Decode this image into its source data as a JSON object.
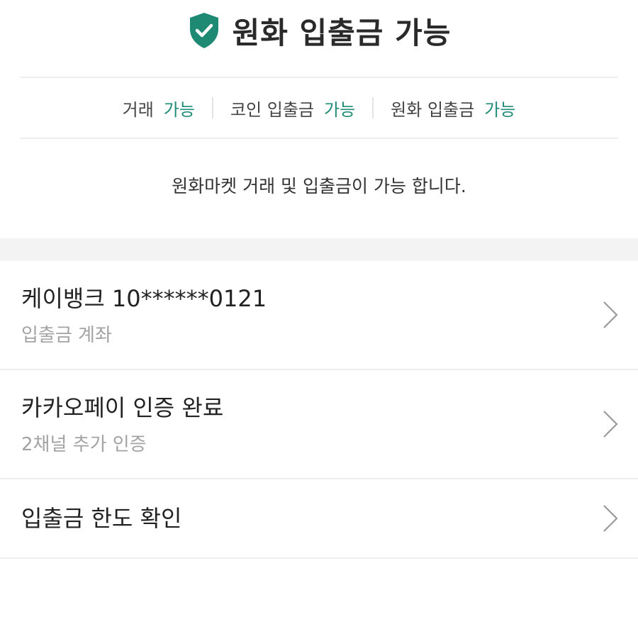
{
  "header": {
    "title": "원화 입출금 가능",
    "icon": "shield-check-icon",
    "accent_color": "#1e8a73"
  },
  "status": [
    {
      "label": "거래",
      "value": "가능"
    },
    {
      "label": "코인 입출금",
      "value": "가능"
    },
    {
      "label": "원화 입출금",
      "value": "가능"
    }
  ],
  "description": "원화마켓 거래 및 입출금이 가능 합니다.",
  "items": [
    {
      "title": "케이뱅크 10******0121",
      "subtitle": "입출금 계좌"
    },
    {
      "title": "카카오페이 인증 완료",
      "subtitle": "2채널 추가 인증"
    },
    {
      "title": "입출금 한도 확인"
    }
  ]
}
